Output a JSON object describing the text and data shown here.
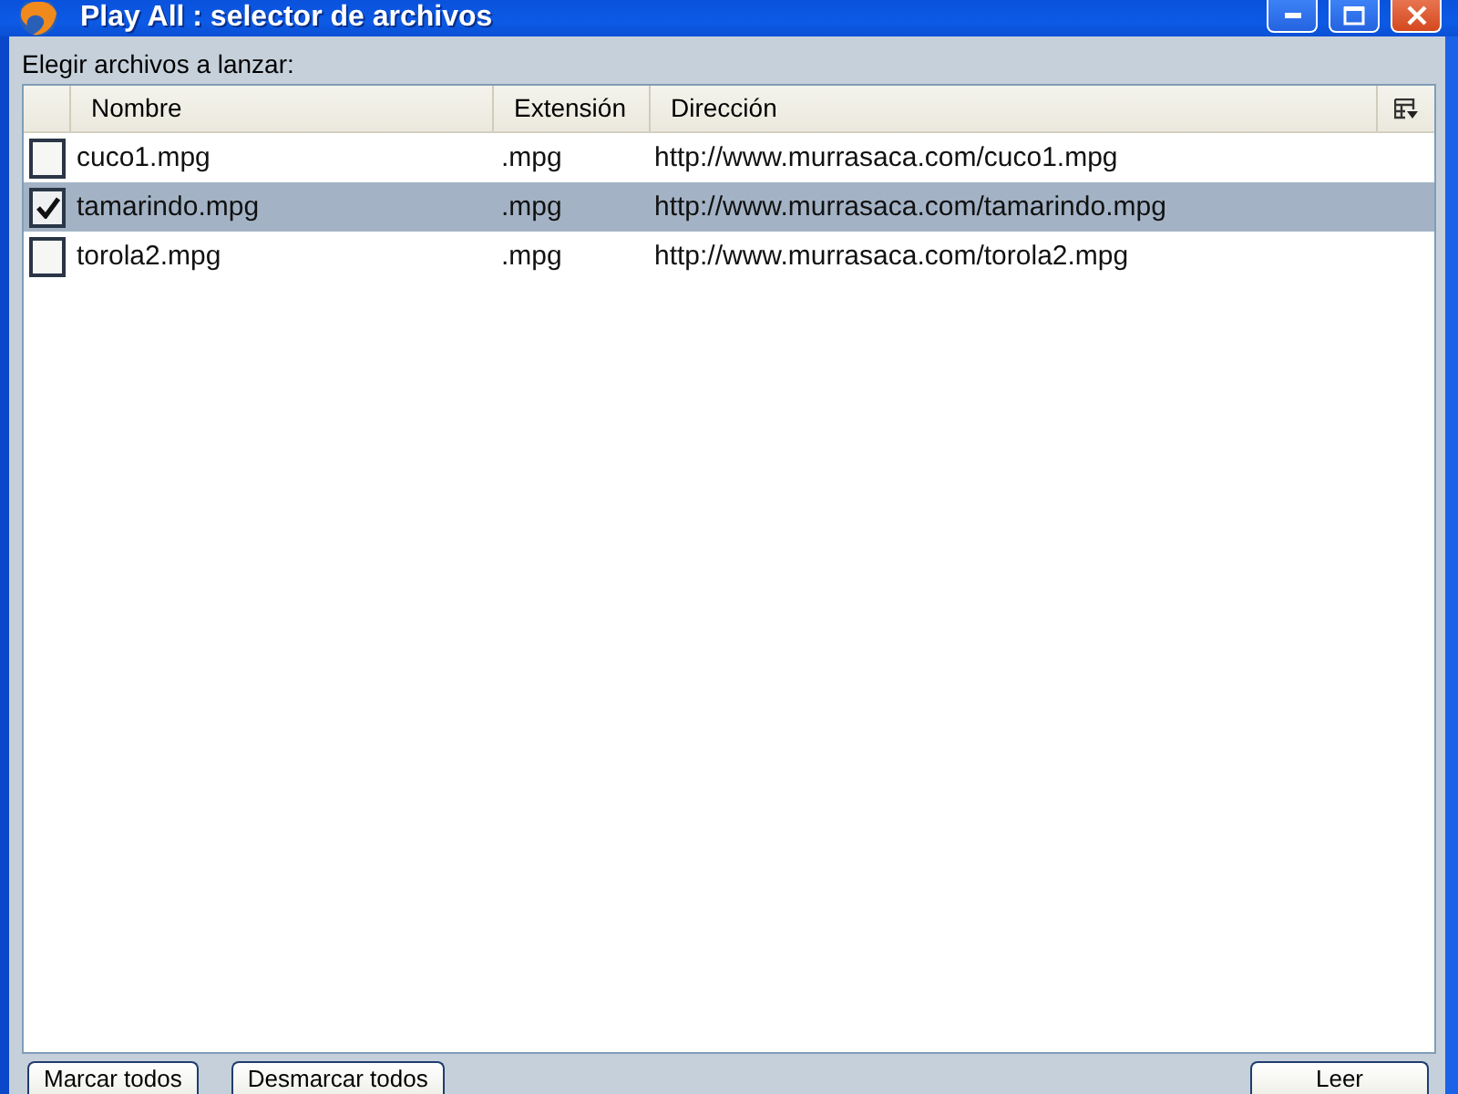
{
  "window": {
    "title": "Play All : selector de archivos"
  },
  "prompt": "Elegir archivos a lanzar:",
  "table": {
    "columns": [
      "Nombre",
      "Extensión",
      "Dirección"
    ],
    "rows": [
      {
        "name": "cuco1.mpg",
        "extension": ".mpg",
        "address": "http://www.murrasaca.com/cuco1.mpg",
        "checked": false,
        "selected": false
      },
      {
        "name": "tamarindo.mpg",
        "extension": ".mpg",
        "address": "http://www.murrasaca.com/tamarindo.mpg",
        "checked": true,
        "selected": true
      },
      {
        "name": "torola2.mpg",
        "extension": ".mpg",
        "address": "http://www.murrasaca.com/torola2.mpg",
        "checked": false,
        "selected": false
      }
    ]
  },
  "actions": {
    "left": [
      "Marcar todos",
      "Desmarcar todos"
    ],
    "right": [
      "Leer"
    ]
  }
}
